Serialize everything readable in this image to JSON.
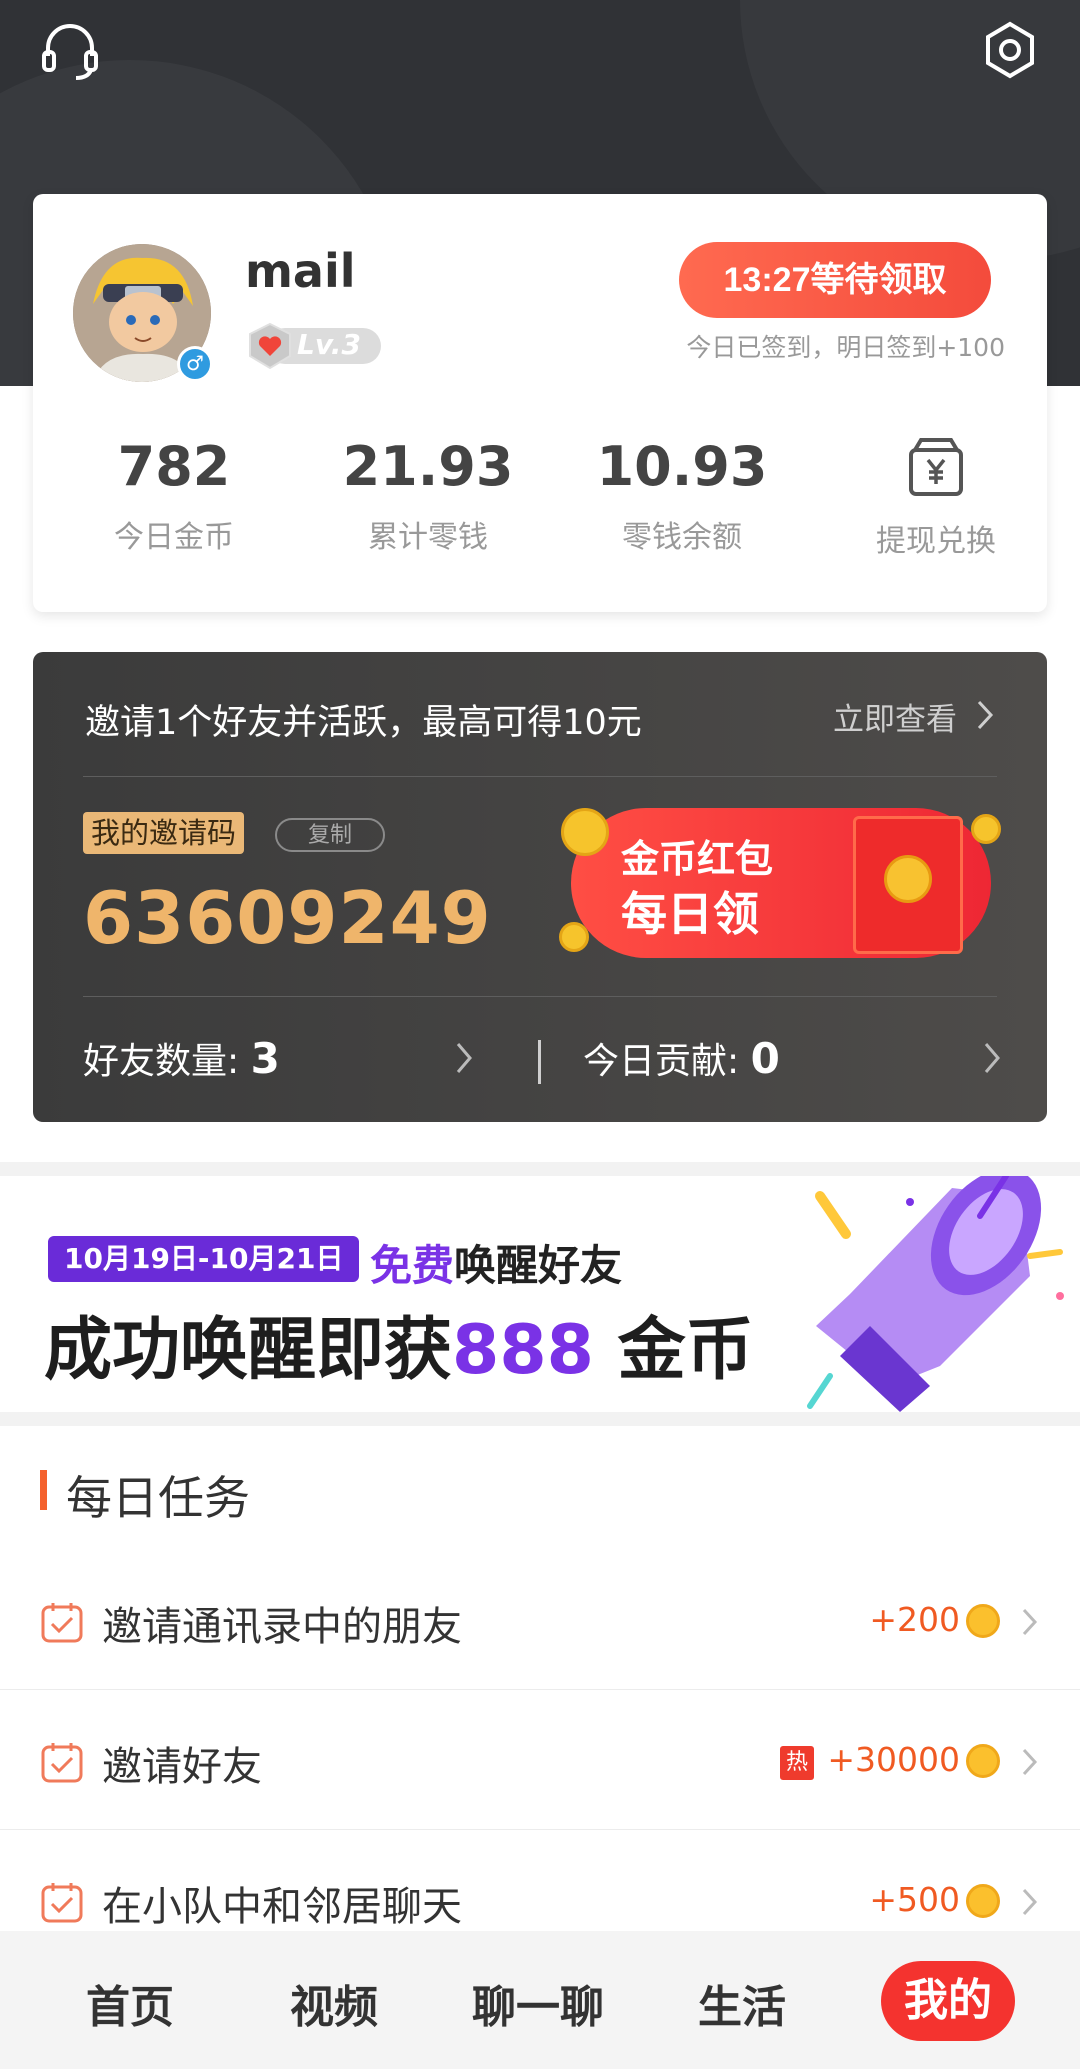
{
  "profile": {
    "username": "mail",
    "level": "Lv.3",
    "claim_button": "13:27等待领取",
    "signin_note": "今日已签到，明日签到+100",
    "stats": [
      {
        "value": "782",
        "label": "今日金币"
      },
      {
        "value": "21.93",
        "label": "累计零钱"
      },
      {
        "value": "10.93",
        "label": "零钱余额"
      }
    ],
    "withdraw_label": "提现兑换"
  },
  "invite": {
    "title": "邀请1个好友并活跃，最高可得10元",
    "view_label": "立即查看",
    "code_label": "我的邀请码",
    "copy_label": "复制",
    "code": "63609249",
    "redpacket_line1": "金币红包",
    "redpacket_line2": "每日领",
    "friends_label": "好友数量:",
    "friends_count": "3",
    "contribution_label": "今日贡献:",
    "contribution_value": "0"
  },
  "banner": {
    "date_range": "10月19日-10月21日",
    "sub_highlight": "免费",
    "sub_rest": "唤醒好友",
    "main_part1": "成功唤醒即获",
    "main_highlight": "888",
    "main_part2": " 金币"
  },
  "tasks": {
    "heading": "每日任务",
    "items": [
      {
        "label": "邀请通讯录中的朋友",
        "reward": "+200"
      },
      {
        "label": "邀请好友",
        "reward": "+30000",
        "badge": "热"
      },
      {
        "label": "在小队中和邻居聊天",
        "reward": "+500"
      }
    ]
  },
  "nav": {
    "items": [
      "首页",
      "视频",
      "聊一聊",
      "生活"
    ],
    "active": "我的"
  },
  "colors": {
    "accent_red": "#f4332f",
    "orange": "#f05a22",
    "gold_code": "#efb56b",
    "purple": "#7a32e6"
  }
}
